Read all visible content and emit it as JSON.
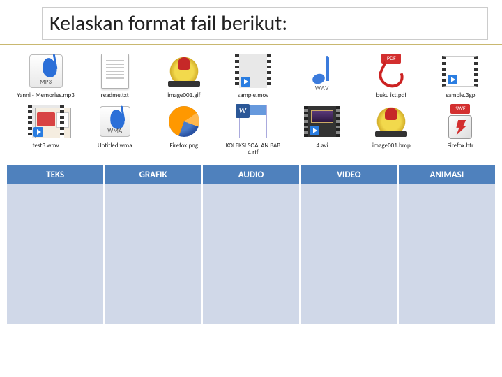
{
  "title": "Kelaskan format fail berikut:",
  "files_row1": [
    {
      "label": "Yanni - Memories.mp3",
      "icon": "mp3"
    },
    {
      "label": "readme.txt",
      "icon": "txt"
    },
    {
      "label": "image001.gif",
      "icon": "crest"
    },
    {
      "label": "sample.mov",
      "icon": "video"
    },
    {
      "label": "",
      "icon": "wav",
      "badge": "WAV"
    },
    {
      "label": "buku ict.pdf",
      "icon": "pdf",
      "badge": "PDF"
    },
    {
      "label": "sample.3gp",
      "icon": "blankvid"
    }
  ],
  "files_row2": [
    {
      "label": "test3.wmv",
      "icon": "wmv"
    },
    {
      "label": "Untitled.wma",
      "icon": "wma"
    },
    {
      "label": "Firefox.png",
      "icon": "firefox"
    },
    {
      "label": "KOLEKSI SOALAN BAB 4.rtf",
      "icon": "word"
    },
    {
      "label": "4.avi",
      "icon": "avi"
    },
    {
      "label": "image001.bmp",
      "icon": "crest"
    },
    {
      "label": "Firefox.htr",
      "icon": "swf",
      "badge": "SWF"
    }
  ],
  "categories": [
    "TEKS",
    "GRAFIK",
    "AUDIO",
    "VIDEO",
    "ANIMASI"
  ]
}
